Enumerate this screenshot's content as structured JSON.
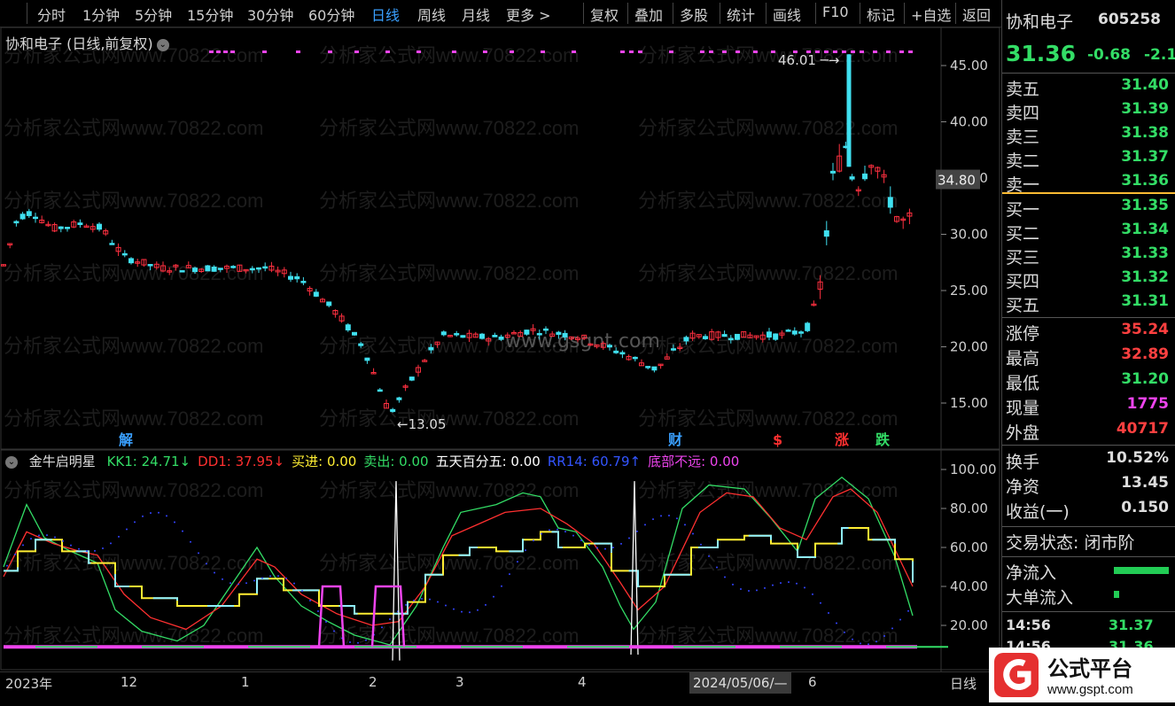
{
  "toolbar": {
    "left": [
      "分时",
      "1分钟",
      "5分钟",
      "15分钟",
      "30分钟",
      "60分钟",
      "日线",
      "周线",
      "月线",
      "更多 >"
    ],
    "right": [
      "复权",
      "叠加",
      "多股",
      "统计",
      "画线",
      "F10",
      "标记",
      "+自选",
      "返回"
    ],
    "active": "日线"
  },
  "chart": {
    "title": "协和电子 (日线,前复权)",
    "high_label": "46.01",
    "low_label": "13.05",
    "cursor_price": "34.80",
    "price_axis": [
      "45.00",
      "40.00",
      "35.00",
      "30.00",
      "25.00",
      "20.00",
      "15.00"
    ],
    "watermark": "分析家公式网www.70822.com",
    "center_watermark": "www.gsgnt.com",
    "event_marks": [
      {
        "text": "解",
        "color": "#3aa0ff"
      },
      {
        "text": "财",
        "color": "#3aa0ff"
      },
      {
        "text": "$",
        "color": "#ff3030"
      },
      {
        "text": "涨",
        "color": "#ff3030"
      },
      {
        "text": "跌",
        "color": "#33dd66"
      }
    ]
  },
  "indicator": {
    "name": "金牛启明星",
    "items": [
      {
        "text": "KK1: 24.71↓",
        "color": "#33dd66"
      },
      {
        "text": "DD1: 37.95↓",
        "color": "#ff3030"
      },
      {
        "text": "买进: 0.00",
        "color": "#ffee33"
      },
      {
        "text": "卖出: 0.00",
        "color": "#33dd66"
      },
      {
        "text": "五天百分五: 0.00",
        "color": "#ffffff"
      },
      {
        "text": "RR14: 60.79↑",
        "color": "#3355ff"
      },
      {
        "text": "底部不远: 0.00",
        "color": "#ee44ee"
      }
    ],
    "axis": [
      "100.00",
      "80.00",
      "60.00",
      "40.00",
      "20.00"
    ]
  },
  "date_axis": {
    "labels": [
      "2023年",
      "12",
      "1",
      "2",
      "3",
      "4",
      "6"
    ],
    "cursor_date": "2024/05/06/—",
    "period": "日线"
  },
  "quote": {
    "name": "协和电子",
    "code": "605258",
    "price": "31.36",
    "change": "-0.68",
    "pct": "-2.1",
    "asks": [
      [
        "卖五",
        "31.40"
      ],
      [
        "卖四",
        "31.39"
      ],
      [
        "卖三",
        "31.38"
      ],
      [
        "卖二",
        "31.37"
      ],
      [
        "卖一",
        "31.36"
      ]
    ],
    "bids": [
      [
        "买一",
        "31.35"
      ],
      [
        "买二",
        "31.34"
      ],
      [
        "买三",
        "31.33"
      ],
      [
        "买四",
        "31.32"
      ],
      [
        "买五",
        "31.31"
      ]
    ],
    "stats": [
      {
        "label": "涨停",
        "value": "35.24",
        "color": "#ff4040"
      },
      {
        "label": "最高",
        "value": "32.89",
        "color": "#ff4040"
      },
      {
        "label": "最低",
        "value": "31.20",
        "color": "#33dd66"
      },
      {
        "label": "现量",
        "value": "1775",
        "color": "#ee44ee"
      },
      {
        "label": "外盘",
        "value": "40717",
        "color": "#ff4040"
      }
    ],
    "stats2": [
      {
        "label": "换手",
        "value": "10.52%"
      },
      {
        "label": "净资",
        "value": "13.45"
      },
      {
        "label": "收益(一)",
        "value": "0.150"
      }
    ],
    "trade_status": "交易状态: 闭市阶",
    "flow": [
      "净流入",
      "大单流入"
    ],
    "ticks": [
      [
        "14:56",
        "31.37"
      ],
      [
        "14:56",
        "31.36"
      ]
    ]
  },
  "logo": {
    "text": "公式平台",
    "url_text": "www.gspt.com"
  }
}
